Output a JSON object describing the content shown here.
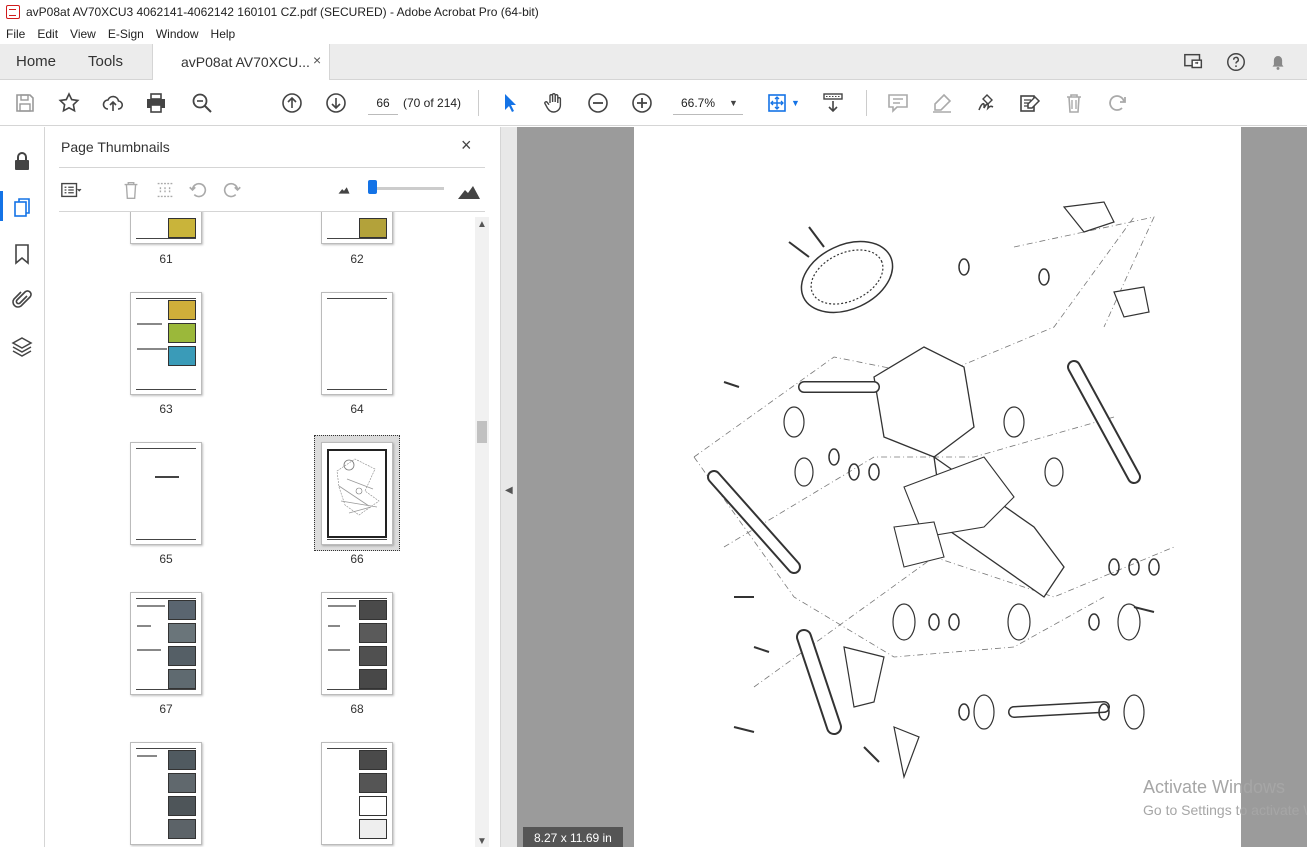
{
  "window": {
    "title": "avP08at AV70XCU3 4062141-4062142 160101 CZ.pdf (SECURED) - Adobe Acrobat Pro (64-bit)"
  },
  "menu": [
    "File",
    "Edit",
    "View",
    "E-Sign",
    "Window",
    "Help"
  ],
  "tabs": {
    "home": "Home",
    "tools": "Tools",
    "document": "avP08at AV70XCU...",
    "close": "×"
  },
  "toolbar": {
    "page_number": "66",
    "page_count": "(70 of 214)",
    "zoom": "66.7%"
  },
  "thumbnails_panel": {
    "title": "Page Thumbnails",
    "close": "×",
    "thumbnails": [
      {
        "label": "61",
        "kind": "photo-cut",
        "selected": false
      },
      {
        "label": "62",
        "kind": "photo-cut",
        "selected": false
      },
      {
        "label": "63",
        "kind": "photos-color",
        "selected": false
      },
      {
        "label": "64",
        "kind": "blank",
        "selected": false
      },
      {
        "label": "65",
        "kind": "title-page",
        "selected": false
      },
      {
        "label": "66",
        "kind": "diagram",
        "selected": true
      },
      {
        "label": "67",
        "kind": "photos-gray",
        "selected": false
      },
      {
        "label": "68",
        "kind": "photos-gray",
        "selected": false
      },
      {
        "label": "",
        "kind": "photos-gray",
        "selected": false
      },
      {
        "label": "",
        "kind": "photos-mixed",
        "selected": false
      }
    ]
  },
  "document_view": {
    "page_size": "8.27 x 11.69 in"
  },
  "watermark": {
    "line1": "Activate Windows",
    "line2": "Go to Settings to activate Windows."
  },
  "colors": {
    "accent": "#1473e6",
    "acrobat_red": "#d01c1c",
    "canvas_gray": "#9b9b9b"
  }
}
